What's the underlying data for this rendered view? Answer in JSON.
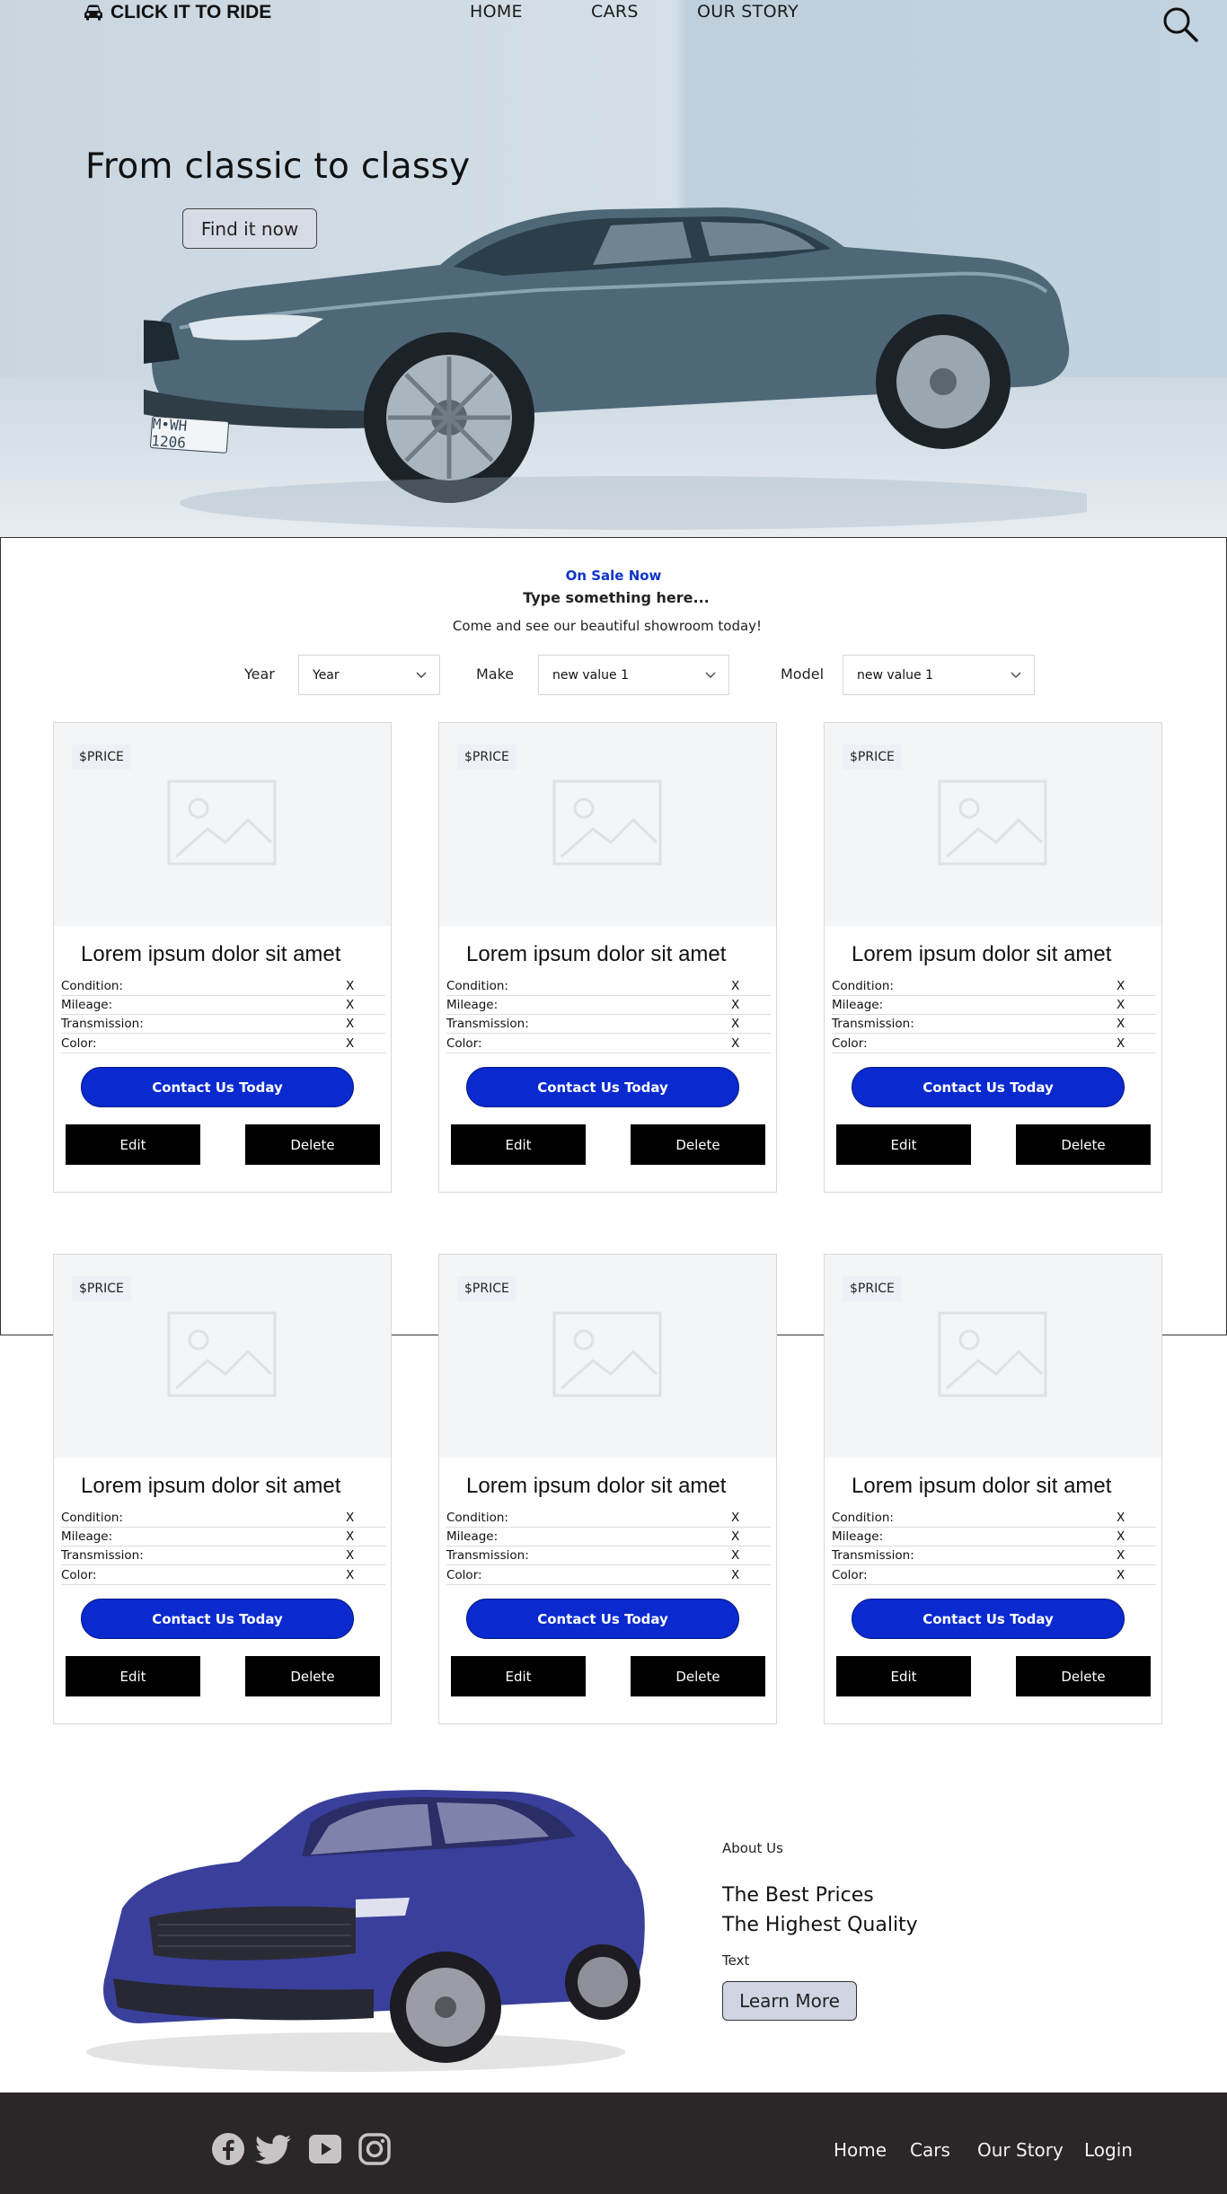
{
  "nav": {
    "brand": "CLICK IT TO RIDE",
    "links": [
      "HOME",
      "CARS",
      "OUR STORY"
    ]
  },
  "hero": {
    "title": "From classic to classy",
    "button": "Find it now",
    "plate": "M•WH 1206"
  },
  "sale": {
    "kicker": "On Sale Now",
    "heading": "Type something here...",
    "subtext": "Come and see our beautiful showroom today!",
    "filters": [
      {
        "label": "Year",
        "value": "Year"
      },
      {
        "label": "Make",
        "value": "new value 1"
      },
      {
        "label": "Model",
        "value": "new value 1"
      }
    ]
  },
  "cards": [
    {
      "price": "$PRICE",
      "title": "Lorem ipsum dolor sit amet",
      "specs": [
        {
          "k": "Condition:",
          "v": "X"
        },
        {
          "k": "Mileage:",
          "v": "X"
        },
        {
          "k": "Transmission:",
          "v": "X"
        },
        {
          "k": "Color:",
          "v": "X"
        }
      ],
      "contact": "Contact Us Today",
      "edit": "Edit",
      "delete": "Delete"
    },
    {
      "price": "$PRICE",
      "title": "Lorem ipsum dolor sit amet",
      "specs": [
        {
          "k": "Condition:",
          "v": "X"
        },
        {
          "k": "Mileage:",
          "v": "X"
        },
        {
          "k": "Transmission:",
          "v": "X"
        },
        {
          "k": "Color:",
          "v": "X"
        }
      ],
      "contact": "Contact Us Today",
      "edit": "Edit",
      "delete": "Delete"
    },
    {
      "price": "$PRICE",
      "title": "Lorem ipsum dolor sit amet",
      "specs": [
        {
          "k": "Condition:",
          "v": "X"
        },
        {
          "k": "Mileage:",
          "v": "X"
        },
        {
          "k": "Transmission:",
          "v": "X"
        },
        {
          "k": "Color:",
          "v": "X"
        }
      ],
      "contact": "Contact Us Today",
      "edit": "Edit",
      "delete": "Delete"
    },
    {
      "price": "$PRICE",
      "title": "Lorem ipsum dolor sit amet",
      "specs": [
        {
          "k": "Condition:",
          "v": "X"
        },
        {
          "k": "Mileage:",
          "v": "X"
        },
        {
          "k": "Transmission:",
          "v": "X"
        },
        {
          "k": "Color:",
          "v": "X"
        }
      ],
      "contact": "Contact Us Today",
      "edit": "Edit",
      "delete": "Delete"
    },
    {
      "price": "$PRICE",
      "title": "Lorem ipsum dolor sit amet",
      "specs": [
        {
          "k": "Condition:",
          "v": "X"
        },
        {
          "k": "Mileage:",
          "v": "X"
        },
        {
          "k": "Transmission:",
          "v": "X"
        },
        {
          "k": "Color:",
          "v": "X"
        }
      ],
      "contact": "Contact Us Today",
      "edit": "Edit",
      "delete": "Delete"
    },
    {
      "price": "$PRICE",
      "title": "Lorem ipsum dolor sit amet",
      "specs": [
        {
          "k": "Condition:",
          "v": "X"
        },
        {
          "k": "Mileage:",
          "v": "X"
        },
        {
          "k": "Transmission:",
          "v": "X"
        },
        {
          "k": "Color:",
          "v": "X"
        }
      ],
      "contact": "Contact Us Today",
      "edit": "Edit",
      "delete": "Delete"
    }
  ],
  "about": {
    "eyebrow": "About Us",
    "line1": "The Best Prices",
    "line2": "The Highest Quality",
    "text": "Text",
    "button": "Learn More"
  },
  "footer": {
    "social": [
      "facebook-icon",
      "twitter-icon",
      "youtube-icon",
      "instagram-icon"
    ],
    "links": [
      "Home",
      "Cars",
      "Our Story",
      "Login"
    ]
  },
  "colors": {
    "accent_blue": "#0a2ad0",
    "kicker_blue": "#1035c8",
    "footer_bg": "#2b2628"
  }
}
